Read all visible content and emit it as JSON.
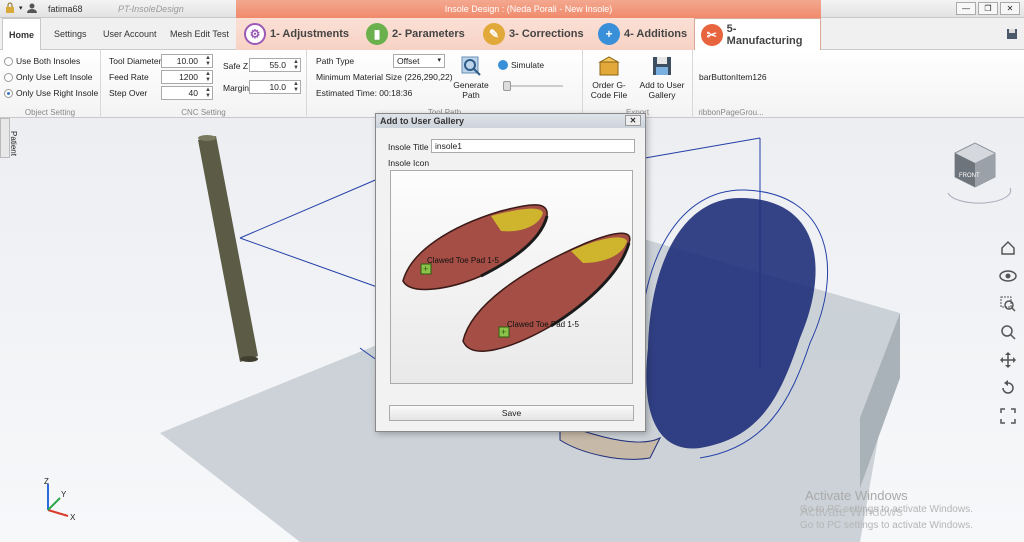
{
  "titlebar": {
    "username": "fatima68",
    "app_title": "PT-InsoleDesign",
    "context_title": "Insole Design : (Neda Porali - New Insole)",
    "window_buttons": [
      "minimize",
      "restore",
      "close"
    ]
  },
  "tabs": {
    "plain": [
      "Home",
      "Settings",
      "User Account",
      "Mesh Edit Test"
    ],
    "context": [
      {
        "label": "1- Adjustments",
        "icon": "gear-icon",
        "color": "#9b59b6"
      },
      {
        "label": "2- Parameters",
        "icon": "chart-icon",
        "color": "#6ab04c"
      },
      {
        "label": "3- Corrections",
        "icon": "pen-icon",
        "color": "#e1a83a"
      },
      {
        "label": "4- Additions",
        "icon": "plus-icon",
        "color": "#3a8fd9"
      },
      {
        "label": "5- Manufacturing",
        "icon": "tools-icon",
        "color": "#e8643f"
      }
    ],
    "active_context": "5- Manufacturing"
  },
  "ribbon": {
    "object_setting": {
      "label": "Object Setting",
      "options": [
        "Use Both Insoles",
        "Only Use Left Insole",
        "Only Use Right Insole"
      ],
      "selected": "Only Use Right Insole"
    },
    "cnc_setting": {
      "label": "CNC Setting",
      "tool_diameter_label": "Tool Diameter",
      "tool_diameter": "10.00",
      "feed_rate_label": "Feed Rate",
      "feed_rate": "1200",
      "step_over_label": "Step Over",
      "step_over": "40",
      "safe_z_label": "Safe Z",
      "safe_z": "55.0",
      "margin_label": "Margin",
      "margin": "10.0"
    },
    "tool_path": {
      "label": "Tool Path",
      "path_type_label": "Path Type",
      "path_type": "Offset",
      "min_material": "Minimum Material Size (226,290,22)",
      "estimated_time": "Estimated Time: 00:18:36",
      "generate_path": "Generate Path",
      "simulate": "Simulate"
    },
    "export": {
      "label": "Export",
      "order": "Order G-Code File",
      "add_gallery": "Add to User Gallery"
    },
    "extra": {
      "label": "ribbonPageGrou...",
      "item": "barButtonItem126"
    }
  },
  "viewport": {
    "side_tab": "Patient",
    "view_cube_label": "FRONT",
    "axis_labels": [
      "Z",
      "Y",
      "X"
    ],
    "nav_icons": [
      "home-icon",
      "eye-icon",
      "zoom-window-icon",
      "zoom-icon",
      "pan-icon",
      "rotate-icon",
      "fit-icon"
    ]
  },
  "dialog": {
    "title": "Add to User Gallery",
    "insole_title_label": "Insole Title",
    "insole_title_value": "insole1",
    "insole_icon_label": "Insole Icon",
    "pad_label_1": "Clawed Toe Pad 1-5",
    "pad_label_2": "Clawed Toe Pad 1-5",
    "save_label": "Save"
  },
  "watermark": {
    "line1": "Activate Windows",
    "line2": "Go to PC settings to activate Windows.",
    "line1_b": "Activate Windows",
    "line2_b": "Go to PC settings to activate Windows."
  }
}
